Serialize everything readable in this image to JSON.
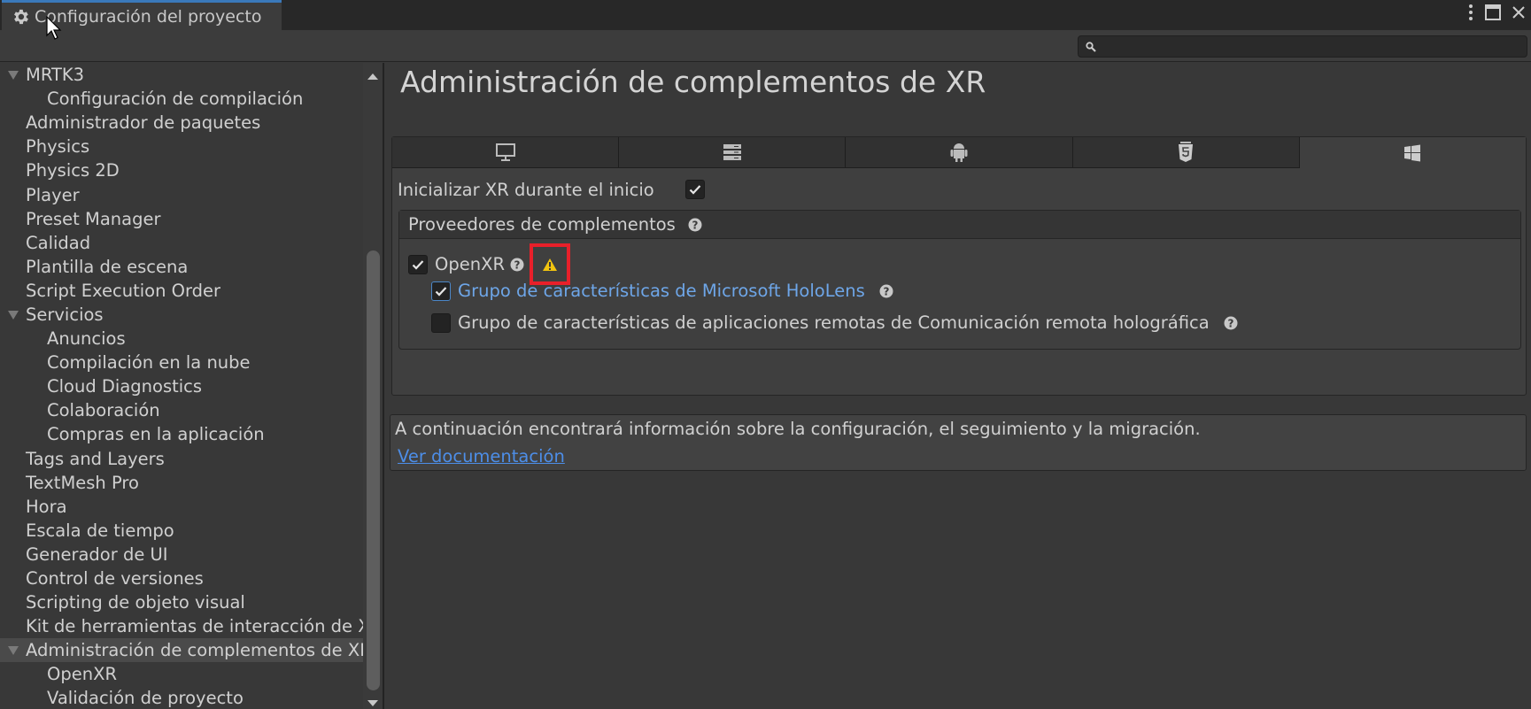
{
  "window": {
    "tab_title": "Configuración del proyecto",
    "icons": {
      "tab": "gear-icon",
      "menu": "kebab-menu-icon",
      "maximize": "maximize-icon",
      "close": "close-icon"
    }
  },
  "search": {
    "value": "",
    "placeholder": "",
    "icon": "search-icon"
  },
  "sidebar": {
    "items": [
      {
        "label": "MRTK3",
        "level": 0,
        "expanded": true
      },
      {
        "label": "Configuración de compilación",
        "level": 1
      },
      {
        "label": "Administrador de paquetes",
        "level": 0
      },
      {
        "label": "Physics",
        "level": 0
      },
      {
        "label": "Physics 2D",
        "level": 0
      },
      {
        "label": "Player",
        "level": 0
      },
      {
        "label": "Preset Manager",
        "level": 0
      },
      {
        "label": "Calidad",
        "level": 0
      },
      {
        "label": "Plantilla de escena",
        "level": 0
      },
      {
        "label": "Script Execution Order",
        "level": 0
      },
      {
        "label": "Servicios",
        "level": 0,
        "expanded": true
      },
      {
        "label": "Anuncios",
        "level": 1
      },
      {
        "label": "Compilación en la nube",
        "level": 1
      },
      {
        "label": "Cloud Diagnostics",
        "level": 1
      },
      {
        "label": "Colaboración",
        "level": 1
      },
      {
        "label": "Compras en la aplicación",
        "level": 1
      },
      {
        "label": "Tags and Layers",
        "level": 0
      },
      {
        "label": "TextMesh Pro",
        "level": 0
      },
      {
        "label": "Hora",
        "level": 0
      },
      {
        "label": "Escala de tiempo",
        "level": 0
      },
      {
        "label": "Generador de UI",
        "level": 0
      },
      {
        "label": "Control de versiones",
        "level": 0
      },
      {
        "label": "Scripting de objeto visual",
        "level": 0
      },
      {
        "label": "Kit de herramientas de interacción de XR",
        "level": 0
      },
      {
        "label": "Administración de complementos de XR",
        "level": 0,
        "expanded": true,
        "selected": true
      },
      {
        "label": "OpenXR",
        "level": 1
      },
      {
        "label": "Validación de proyecto",
        "level": 1
      }
    ]
  },
  "main": {
    "title": "Administración de complementos de XR",
    "platform_tabs": [
      {
        "name": "standalone",
        "icon": "monitor-icon",
        "active": false
      },
      {
        "name": "dedicated-server",
        "icon": "server-icon",
        "active": false
      },
      {
        "name": "android",
        "icon": "android-icon",
        "active": false
      },
      {
        "name": "webgl",
        "icon": "html5-icon",
        "active": false
      },
      {
        "name": "windows-uwp",
        "icon": "windows-icon",
        "active": true
      }
    ],
    "init_xr": {
      "label": "Inicializar XR durante el inicio",
      "checked": true
    },
    "providers": {
      "header": "Proveedores de complementos",
      "items": [
        {
          "label": "OpenXR",
          "checked": true,
          "warning": true
        },
        {
          "label": "Grupo de características de Microsoft HoloLens",
          "checked": true,
          "color": "#6ea6e8"
        },
        {
          "label": "Grupo de características de aplicaciones remotas de Comunicación remota holográfica",
          "checked": false
        }
      ]
    },
    "info": {
      "text": "A continuación encontrará información sobre la configuración, el seguimiento y la migración.",
      "link": "Ver documentación"
    }
  },
  "colors": {
    "accent_tab": "#3a79bb",
    "link": "#4d8ee8",
    "feature_link": "#6ea6e8",
    "warning": "#f2c40f",
    "highlight_box": "#e8202a"
  }
}
